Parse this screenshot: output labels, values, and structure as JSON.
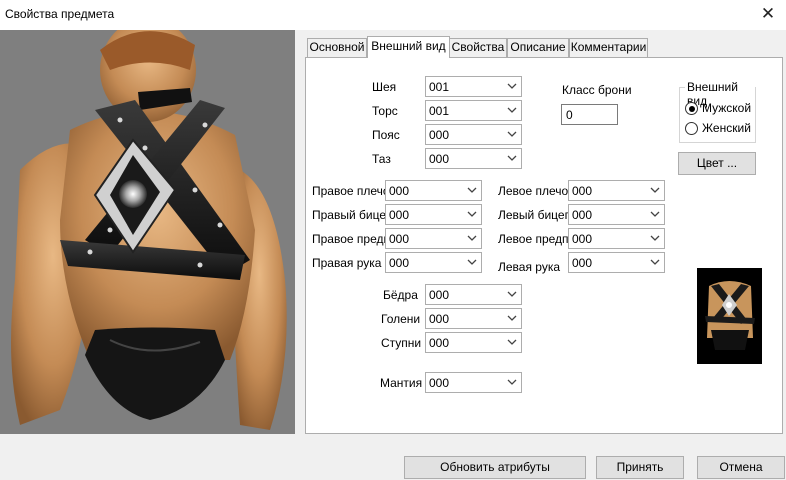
{
  "window": {
    "title": "Свойства предмета"
  },
  "tabs": [
    {
      "label": "Основной",
      "active": false
    },
    {
      "label": "Внешний вид",
      "active": true
    },
    {
      "label": "Свойства",
      "active": false
    },
    {
      "label": "Описание",
      "active": false
    },
    {
      "label": "Комментарии",
      "active": false
    }
  ],
  "appearance": {
    "neck": {
      "label": "Шея",
      "value": "001"
    },
    "torso": {
      "label": "Торс",
      "value": "001"
    },
    "belt": {
      "label": "Пояс",
      "value": "000"
    },
    "pelvis": {
      "label": "Таз",
      "value": "000"
    },
    "right_shoulder": {
      "label": "Правое плечо",
      "value": "000"
    },
    "right_bicep": {
      "label": "Правый бицепс",
      "value": "000"
    },
    "right_forearm": {
      "label": "Правое предплечье",
      "value": "000"
    },
    "right_hand": {
      "label": "Правая рука",
      "value": "000"
    },
    "left_shoulder": {
      "label": "Левое плечо",
      "value": "000"
    },
    "left_bicep": {
      "label": "Левый бицепс",
      "value": "000"
    },
    "left_forearm": {
      "label": "Левое предплечье",
      "value": "000"
    },
    "left_hand": {
      "label": "Левая рука",
      "value": "000"
    },
    "thighs": {
      "label": "Бёдра",
      "value": "000"
    },
    "shins": {
      "label": "Голени",
      "value": "000"
    },
    "feet": {
      "label": "Ступни",
      "value": "000"
    },
    "robe": {
      "label": "Мантия",
      "value": "000"
    }
  },
  "armor_class": {
    "label": "Класс брони",
    "value": "0"
  },
  "appearance_group": {
    "title": "Внешний вид",
    "options": [
      {
        "label": "Мужской",
        "selected": true
      },
      {
        "label": "Женский",
        "selected": false
      }
    ]
  },
  "color_button": "Цвет ...",
  "footer": {
    "update_label": "Обновить атрибуты",
    "accept_label": "Принять",
    "cancel_label": "Отмена"
  },
  "icons": {
    "close": "close-icon",
    "dropdown": "chevron-down-icon"
  }
}
